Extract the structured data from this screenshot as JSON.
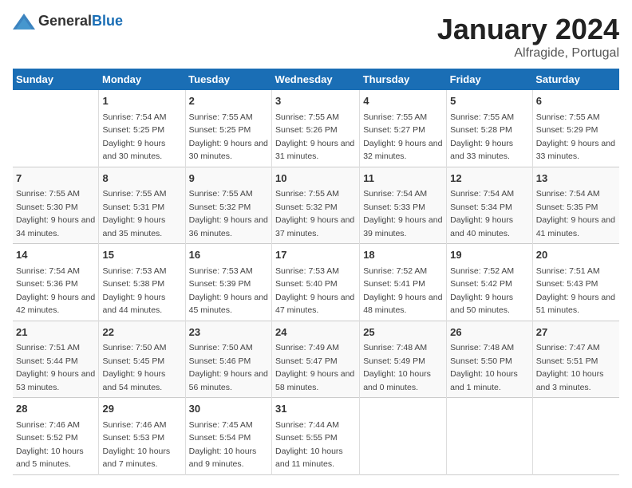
{
  "header": {
    "logo_general": "General",
    "logo_blue": "Blue",
    "month": "January 2024",
    "location": "Alfragide, Portugal"
  },
  "days_of_week": [
    "Sunday",
    "Monday",
    "Tuesday",
    "Wednesday",
    "Thursday",
    "Friday",
    "Saturday"
  ],
  "weeks": [
    [
      {
        "num": "",
        "sunrise": "",
        "sunset": "",
        "daylight": ""
      },
      {
        "num": "1",
        "sunrise": "Sunrise: 7:54 AM",
        "sunset": "Sunset: 5:25 PM",
        "daylight": "Daylight: 9 hours and 30 minutes."
      },
      {
        "num": "2",
        "sunrise": "Sunrise: 7:55 AM",
        "sunset": "Sunset: 5:25 PM",
        "daylight": "Daylight: 9 hours and 30 minutes."
      },
      {
        "num": "3",
        "sunrise": "Sunrise: 7:55 AM",
        "sunset": "Sunset: 5:26 PM",
        "daylight": "Daylight: 9 hours and 31 minutes."
      },
      {
        "num": "4",
        "sunrise": "Sunrise: 7:55 AM",
        "sunset": "Sunset: 5:27 PM",
        "daylight": "Daylight: 9 hours and 32 minutes."
      },
      {
        "num": "5",
        "sunrise": "Sunrise: 7:55 AM",
        "sunset": "Sunset: 5:28 PM",
        "daylight": "Daylight: 9 hours and 33 minutes."
      },
      {
        "num": "6",
        "sunrise": "Sunrise: 7:55 AM",
        "sunset": "Sunset: 5:29 PM",
        "daylight": "Daylight: 9 hours and 33 minutes."
      }
    ],
    [
      {
        "num": "7",
        "sunrise": "Sunrise: 7:55 AM",
        "sunset": "Sunset: 5:30 PM",
        "daylight": "Daylight: 9 hours and 34 minutes."
      },
      {
        "num": "8",
        "sunrise": "Sunrise: 7:55 AM",
        "sunset": "Sunset: 5:31 PM",
        "daylight": "Daylight: 9 hours and 35 minutes."
      },
      {
        "num": "9",
        "sunrise": "Sunrise: 7:55 AM",
        "sunset": "Sunset: 5:32 PM",
        "daylight": "Daylight: 9 hours and 36 minutes."
      },
      {
        "num": "10",
        "sunrise": "Sunrise: 7:55 AM",
        "sunset": "Sunset: 5:32 PM",
        "daylight": "Daylight: 9 hours and 37 minutes."
      },
      {
        "num": "11",
        "sunrise": "Sunrise: 7:54 AM",
        "sunset": "Sunset: 5:33 PM",
        "daylight": "Daylight: 9 hours and 39 minutes."
      },
      {
        "num": "12",
        "sunrise": "Sunrise: 7:54 AM",
        "sunset": "Sunset: 5:34 PM",
        "daylight": "Daylight: 9 hours and 40 minutes."
      },
      {
        "num": "13",
        "sunrise": "Sunrise: 7:54 AM",
        "sunset": "Sunset: 5:35 PM",
        "daylight": "Daylight: 9 hours and 41 minutes."
      }
    ],
    [
      {
        "num": "14",
        "sunrise": "Sunrise: 7:54 AM",
        "sunset": "Sunset: 5:36 PM",
        "daylight": "Daylight: 9 hours and 42 minutes."
      },
      {
        "num": "15",
        "sunrise": "Sunrise: 7:53 AM",
        "sunset": "Sunset: 5:38 PM",
        "daylight": "Daylight: 9 hours and 44 minutes."
      },
      {
        "num": "16",
        "sunrise": "Sunrise: 7:53 AM",
        "sunset": "Sunset: 5:39 PM",
        "daylight": "Daylight: 9 hours and 45 minutes."
      },
      {
        "num": "17",
        "sunrise": "Sunrise: 7:53 AM",
        "sunset": "Sunset: 5:40 PM",
        "daylight": "Daylight: 9 hours and 47 minutes."
      },
      {
        "num": "18",
        "sunrise": "Sunrise: 7:52 AM",
        "sunset": "Sunset: 5:41 PM",
        "daylight": "Daylight: 9 hours and 48 minutes."
      },
      {
        "num": "19",
        "sunrise": "Sunrise: 7:52 AM",
        "sunset": "Sunset: 5:42 PM",
        "daylight": "Daylight: 9 hours and 50 minutes."
      },
      {
        "num": "20",
        "sunrise": "Sunrise: 7:51 AM",
        "sunset": "Sunset: 5:43 PM",
        "daylight": "Daylight: 9 hours and 51 minutes."
      }
    ],
    [
      {
        "num": "21",
        "sunrise": "Sunrise: 7:51 AM",
        "sunset": "Sunset: 5:44 PM",
        "daylight": "Daylight: 9 hours and 53 minutes."
      },
      {
        "num": "22",
        "sunrise": "Sunrise: 7:50 AM",
        "sunset": "Sunset: 5:45 PM",
        "daylight": "Daylight: 9 hours and 54 minutes."
      },
      {
        "num": "23",
        "sunrise": "Sunrise: 7:50 AM",
        "sunset": "Sunset: 5:46 PM",
        "daylight": "Daylight: 9 hours and 56 minutes."
      },
      {
        "num": "24",
        "sunrise": "Sunrise: 7:49 AM",
        "sunset": "Sunset: 5:47 PM",
        "daylight": "Daylight: 9 hours and 58 minutes."
      },
      {
        "num": "25",
        "sunrise": "Sunrise: 7:48 AM",
        "sunset": "Sunset: 5:49 PM",
        "daylight": "Daylight: 10 hours and 0 minutes."
      },
      {
        "num": "26",
        "sunrise": "Sunrise: 7:48 AM",
        "sunset": "Sunset: 5:50 PM",
        "daylight": "Daylight: 10 hours and 1 minute."
      },
      {
        "num": "27",
        "sunrise": "Sunrise: 7:47 AM",
        "sunset": "Sunset: 5:51 PM",
        "daylight": "Daylight: 10 hours and 3 minutes."
      }
    ],
    [
      {
        "num": "28",
        "sunrise": "Sunrise: 7:46 AM",
        "sunset": "Sunset: 5:52 PM",
        "daylight": "Daylight: 10 hours and 5 minutes."
      },
      {
        "num": "29",
        "sunrise": "Sunrise: 7:46 AM",
        "sunset": "Sunset: 5:53 PM",
        "daylight": "Daylight: 10 hours and 7 minutes."
      },
      {
        "num": "30",
        "sunrise": "Sunrise: 7:45 AM",
        "sunset": "Sunset: 5:54 PM",
        "daylight": "Daylight: 10 hours and 9 minutes."
      },
      {
        "num": "31",
        "sunrise": "Sunrise: 7:44 AM",
        "sunset": "Sunset: 5:55 PM",
        "daylight": "Daylight: 10 hours and 11 minutes."
      },
      {
        "num": "",
        "sunrise": "",
        "sunset": "",
        "daylight": ""
      },
      {
        "num": "",
        "sunrise": "",
        "sunset": "",
        "daylight": ""
      },
      {
        "num": "",
        "sunrise": "",
        "sunset": "",
        "daylight": ""
      }
    ]
  ]
}
